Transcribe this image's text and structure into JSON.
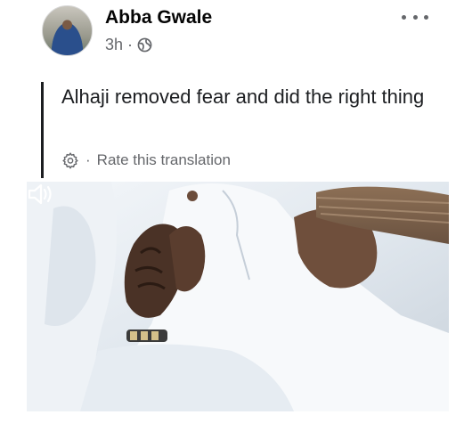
{
  "post": {
    "author": "Abba Gwale",
    "time": "3h",
    "separator": "·",
    "privacy_icon": "globe-icon",
    "more_icon": "more-horizontal-icon"
  },
  "translation": {
    "text": "Alhaji removed fear and did the right thing",
    "settings_icon": "gear-icon",
    "dot": "·",
    "rate_label": "Rate this translation"
  },
  "media": {
    "type": "video",
    "volume_icon": "volume-icon"
  },
  "colors": {
    "text_primary": "#050505",
    "text_secondary": "#65676b",
    "rule": "#1c1e21"
  }
}
